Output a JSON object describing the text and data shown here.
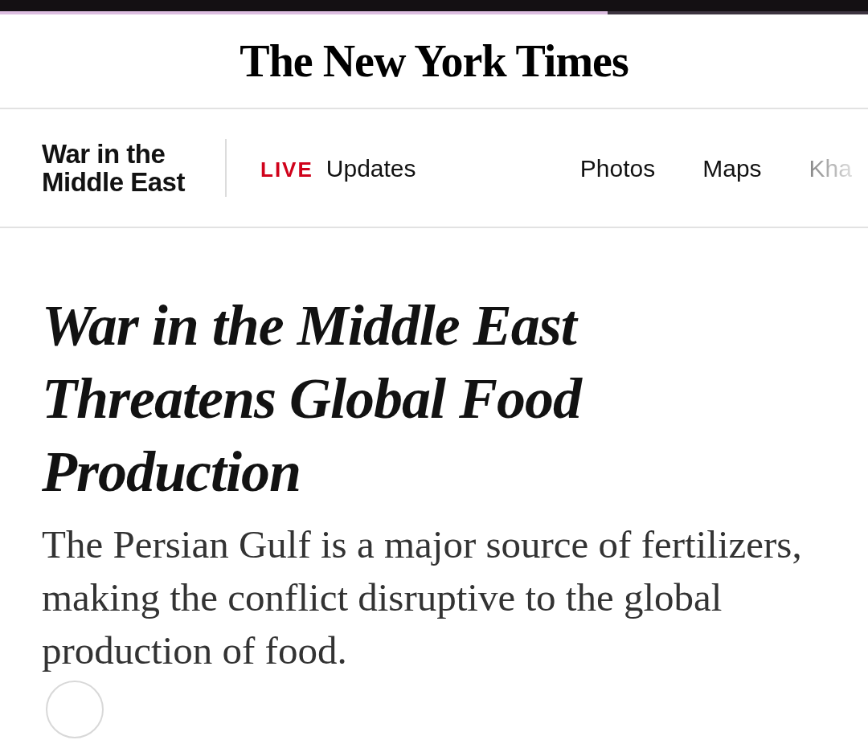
{
  "reading_progress": {
    "level": 0.7
  },
  "masthead": {
    "logo": "The New York Times"
  },
  "section_nav": {
    "title": "War in the Middle East",
    "items": [
      {
        "kind": "live",
        "badge": "LIVE",
        "label": "Updates"
      },
      {
        "kind": "link",
        "label": "Photos"
      },
      {
        "kind": "link",
        "label": "Maps"
      },
      {
        "kind": "faded",
        "label": "Kha"
      }
    ]
  },
  "article": {
    "headline": "War in the Middle East Threatens Global Food Production",
    "summary": "The Persian Gulf is a major source of fertilizers, making the conflict disruptive to the global production of food."
  }
}
